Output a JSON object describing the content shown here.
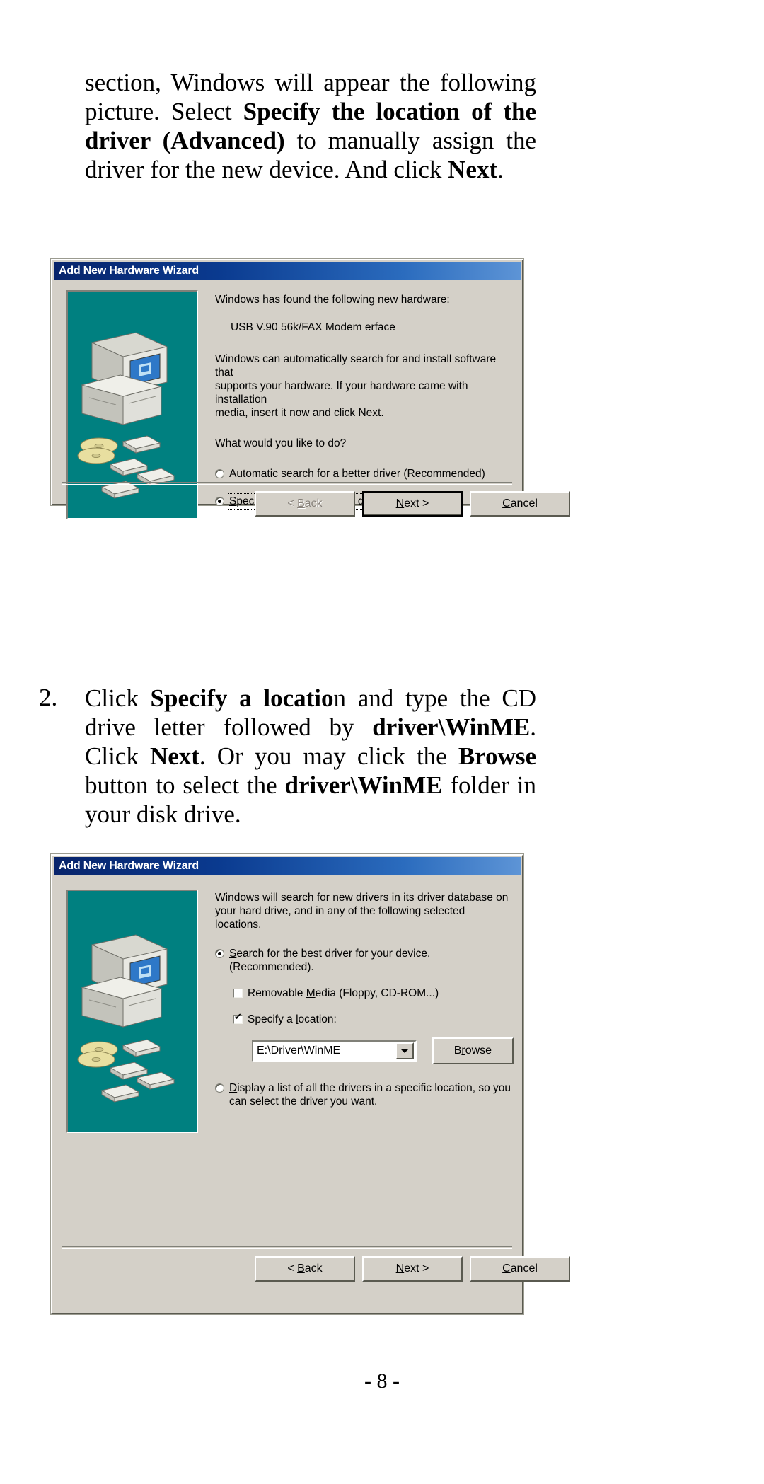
{
  "document": {
    "page_number": "- 8 -",
    "paragraph_1": {
      "line_1_a": "section, Windows will appear the following",
      "line_2_a": "picture. Select ",
      "line_2_b": "Specify the location of the",
      "line_3_a": "driver (Advanced)",
      "line_3_b": " to manually assign the",
      "line_4_a": "driver  for the new device.  And click ",
      "line_4_b": "Next",
      "line_4_c": "."
    },
    "paragraph_2": {
      "number": "2.",
      "line_1_a": "Click ",
      "line_1_b": "Specify a locatio",
      "line_1_c": "n and type the CD",
      "line_2_a": "drive letter followed by ",
      "line_2_b": "driver\\WinME",
      "line_2_c": ".",
      "line_3_a": "Click ",
      "line_3_b": "Next",
      "line_3_c": ".  Or you may click the ",
      "line_3_d": "Browse",
      "line_4_a": "button to select the ",
      "line_4_b": "driver\\WinME",
      "line_4_c": " folder in",
      "line_5_a": "your disk drive."
    }
  },
  "dialog_1": {
    "title": "Add New Hardware Wizard",
    "heading": "Windows has found the following new hardware:",
    "device_name": "USB V.90 56k/FAX Modem erface",
    "description_line_1": "Windows can automatically search for and install software that",
    "description_line_2": "supports your hardware. If your hardware came with installation",
    "description_line_3": "media, insert it now and click Next.",
    "question": "What would you like to do?",
    "options": [
      {
        "label_pre": "A",
        "label_post": "utomatic search for a better driver (Recommended)",
        "selected": false,
        "focused": false
      },
      {
        "label_pre": "S",
        "label_post": "pecify the location of the driver (Advanced)",
        "selected": true,
        "focused": true
      }
    ],
    "buttons": [
      {
        "name": "back",
        "pre": "< ",
        "acc": "B",
        "post": "ack",
        "state": "disabled"
      },
      {
        "name": "next",
        "pre": "",
        "acc": "N",
        "post": "ext >",
        "state": "default"
      },
      {
        "name": "cancel",
        "pre": "",
        "acc": "C",
        "post": "ancel",
        "state": "normal"
      }
    ]
  },
  "dialog_2": {
    "title": "Add New Hardware Wizard",
    "description_line_1": "Windows will search for new drivers in its driver database on",
    "description_line_2": "your hard drive, and in any of the following selected locations.",
    "radio_search": {
      "line_1_pre": "S",
      "line_1_post": "earch for the best driver for your device.",
      "line_2": "(Recommended).",
      "selected": true
    },
    "check_removable": {
      "pre": "Removable ",
      "acc": "M",
      "post": "edia (Floppy, CD-ROM...)",
      "checked": false
    },
    "check_specify": {
      "pre": "Specify a ",
      "acc": "l",
      "post": "ocation:",
      "checked": true
    },
    "location_value": "E:\\Driver\\WinME",
    "browse_button": {
      "pre": "B",
      "acc": "r",
      "post": "owse"
    },
    "radio_display": {
      "acc": "D",
      "line_1_post": "isplay a list of all the drivers in a specific location, so you",
      "line_2": "can select the driver you want.",
      "selected": false
    },
    "buttons": [
      {
        "name": "back",
        "pre": "< ",
        "acc": "B",
        "post": "ack",
        "state": "normal"
      },
      {
        "name": "next",
        "pre": "",
        "acc": "N",
        "post": "ext >",
        "state": "normal"
      },
      {
        "name": "cancel",
        "pre": "",
        "acc": "C",
        "post": "ancel",
        "state": "normal"
      }
    ]
  },
  "colors": {
    "dialog_face": "#d4d0c8",
    "titlebar_start": "#08246b",
    "titlebar_end": "#5d94d6",
    "art_teal": "#008080"
  }
}
